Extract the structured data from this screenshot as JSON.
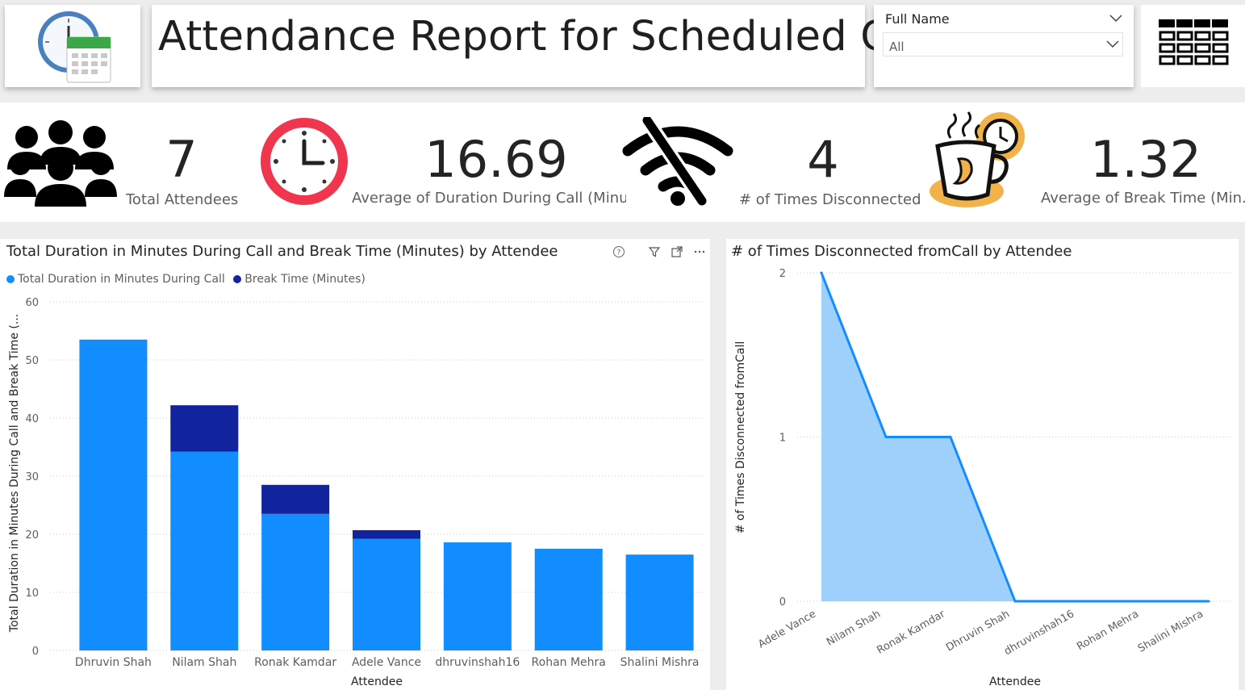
{
  "header": {
    "title": "Attendance Report for Scheduled Call",
    "logo_icon": "clock-calendar-icon",
    "menu_icon": "table-grid-icon"
  },
  "slicer": {
    "label": "Full Name",
    "value": "All"
  },
  "kpis": [
    {
      "value": "7",
      "label": "Total Attendees",
      "icon": "people-group-icon"
    },
    {
      "value": "16.69",
      "label": "Average of Duration During Call (Minut.",
      "icon": "clock-icon"
    },
    {
      "value": "4",
      "label": "# of Times Disconnected",
      "icon": "no-wifi-icon"
    },
    {
      "value": "1.32",
      "label": "Average of Break Time (Min...",
      "icon": "coffee-break-icon"
    }
  ],
  "colors": {
    "duration": "#118dff",
    "break": "#12239e",
    "area_line": "#118dff",
    "area_fill": "#9fd0fb",
    "clock_red": "#f0364f"
  },
  "chart_data": [
    {
      "type": "bar",
      "stacked": true,
      "title": "Total Duration in Minutes During Call and Break Time (Minutes) by Attendee",
      "xlabel": "Attendee",
      "ylabel": "Total Duration in Minutes During Call and Break Time (...",
      "ylim": [
        0,
        60
      ],
      "yticks": [
        0,
        10,
        20,
        30,
        40,
        50,
        60
      ],
      "categories": [
        "Dhruvin Shah",
        "Nilam Shah",
        "Ronak Kamdar",
        "Adele Vance",
        "dhruvinshah16",
        "Rohan Mehra",
        "Shalini Mishra"
      ],
      "series": [
        {
          "name": "Total Duration in Minutes During Call",
          "values": [
            53.5,
            34.2,
            23.5,
            19.2,
            18.6,
            17.5,
            16.5
          ]
        },
        {
          "name": "Break Time (Minutes)",
          "values": [
            0,
            8.0,
            5.0,
            1.5,
            0,
            0,
            0
          ]
        }
      ],
      "legend_position": "top-left",
      "grid": true
    },
    {
      "type": "area",
      "title": "# of Times Disconnected fromCall by Attendee",
      "xlabel": "Attendee",
      "ylabel": "# of Times Disconnected fromCall",
      "ylim": [
        0,
        2
      ],
      "yticks": [
        0,
        1,
        2
      ],
      "categories": [
        "Adele Vance",
        "Nilam Shah",
        "Ronak Kamdar",
        "Dhruvin Shah",
        "dhruvinshah16",
        "Rohan Mehra",
        "Shalini Mishra"
      ],
      "values": [
        2,
        1,
        1,
        0,
        0,
        0,
        0
      ],
      "grid": true
    }
  ]
}
